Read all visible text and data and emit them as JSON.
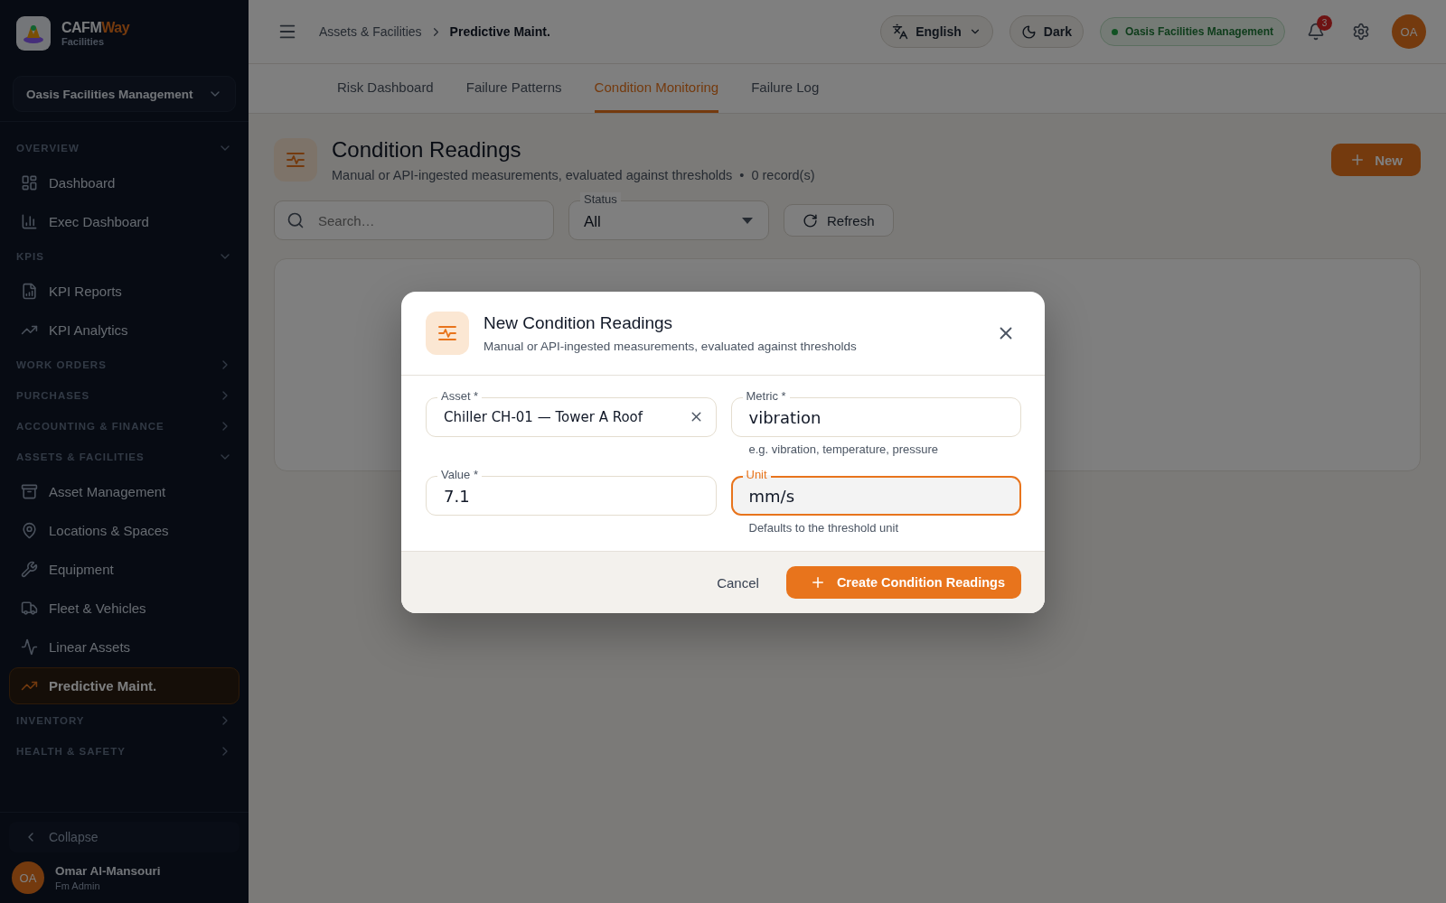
{
  "brand": {
    "name": "CAFM",
    "name_accent": "Way",
    "subtitle": "Facilities"
  },
  "org_selector": {
    "value": "Oasis Facilities Management"
  },
  "nav": [
    {
      "title": "OVERVIEW",
      "expanded": true,
      "items": [
        {
          "label": "Dashboard",
          "selected": false
        },
        {
          "label": "Exec Dashboard",
          "selected": false
        }
      ]
    },
    {
      "title": "KPIS",
      "expanded": true,
      "items": [
        {
          "label": "KPI Reports",
          "selected": false
        },
        {
          "label": "KPI Analytics",
          "selected": false
        }
      ]
    },
    {
      "title": "WORK ORDERS",
      "expanded": false
    },
    {
      "title": "PURCHASES",
      "expanded": false
    },
    {
      "title": "ACCOUNTING & FINANCE",
      "expanded": false
    },
    {
      "title": "ASSETS & FACILITIES",
      "expanded": true,
      "items": [
        {
          "label": "Asset Management",
          "selected": false
        },
        {
          "label": "Locations & Spaces",
          "selected": false
        },
        {
          "label": "Equipment",
          "selected": false
        },
        {
          "label": "Fleet & Vehicles",
          "selected": false
        },
        {
          "label": "Linear Assets",
          "selected": false
        },
        {
          "label": "Predictive Maint.",
          "selected": true
        }
      ]
    },
    {
      "title": "INVENTORY",
      "expanded": false
    },
    {
      "title": "HEALTH & SAFETY",
      "expanded": false
    }
  ],
  "collapse": {
    "label": "Collapse"
  },
  "user": {
    "initials": "OA",
    "name": "Omar Al-Mansouri",
    "role": "Fm Admin"
  },
  "header": {
    "breadcrumb": [
      "Assets & Facilities",
      "Predictive Maint."
    ],
    "language": "English",
    "theme": "Dark",
    "org_badge": "Oasis Facilities Management",
    "notifications": "3",
    "avatar": "OA"
  },
  "tabs": [
    {
      "label": "Risk Dashboard",
      "selected": false
    },
    {
      "label": "Failure Patterns",
      "selected": false
    },
    {
      "label": "Condition Monitoring",
      "selected": true
    },
    {
      "label": "Failure Log",
      "selected": false
    }
  ],
  "page": {
    "title": "Condition Readings",
    "subtitle": "Manual or API-ingested measurements, evaluated against thresholds",
    "separator": "•",
    "record_count": "0 record(s)",
    "new_button": "New",
    "search": {
      "placeholder": "Search…"
    },
    "status_filter": {
      "label": "Status",
      "value": "All"
    },
    "refresh": "Refresh"
  },
  "dialog": {
    "title": "New Condition Readings",
    "subtitle": "Manual or API-ingested measurements, evaluated against thresholds",
    "fields": [
      {
        "kind": "select",
        "label": "Asset *",
        "value": "Chiller CH-01 — Tower A Roof",
        "focused": false
      },
      {
        "kind": "text",
        "label": "Metric *",
        "value": "vibration",
        "helper": "e.g. vibration, temperature, pressure",
        "focused": false
      },
      {
        "kind": "text",
        "label": "Value *",
        "value": "7.1",
        "focused": false
      },
      {
        "kind": "text",
        "label": "Unit",
        "value": "mm/s",
        "helper": "Defaults to the threshold unit",
        "focused": true
      }
    ],
    "cancel": "Cancel",
    "submit": "Create Condition Readings"
  }
}
